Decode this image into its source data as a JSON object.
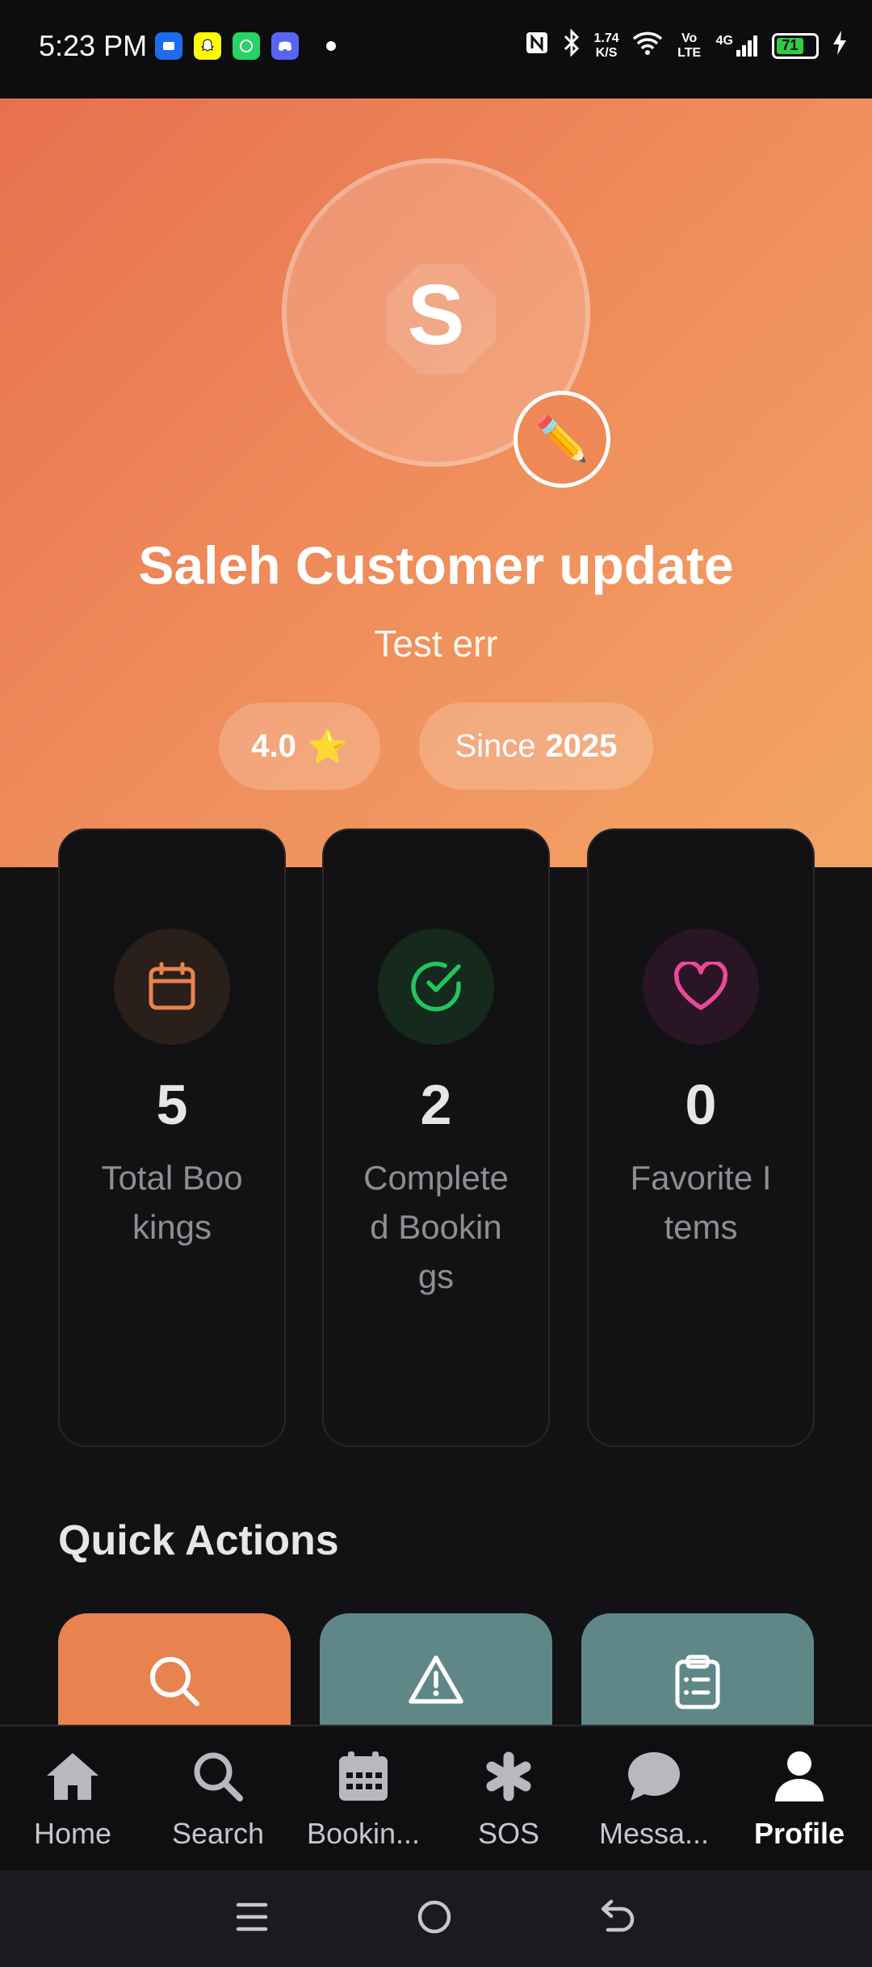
{
  "status_bar": {
    "time": "5:23 PM",
    "net_speed_value": "1.74",
    "net_speed_unit": "K/S",
    "volte": "Vo LTE",
    "network": "4G",
    "battery": "71"
  },
  "profile": {
    "avatar_letter": "S",
    "name": "Saleh Customer update",
    "subtitle": "Test err",
    "rating": "4.0",
    "since_label": "Since",
    "since_year": "2025"
  },
  "stats": [
    {
      "value": "5",
      "label": "Total Bookings",
      "icon": "calendar-icon",
      "color": "#e8834f"
    },
    {
      "value": "2",
      "label": "Completed Bookings",
      "icon": "check-circle-icon",
      "color": "#22c55e"
    },
    {
      "value": "0",
      "label": "Favorite Items",
      "icon": "heart-icon",
      "color": "#ec4899"
    }
  ],
  "quick_actions": {
    "title": "Quick Actions",
    "items": [
      {
        "icon": "search-icon",
        "color": "#e8834f"
      },
      {
        "icon": "warning-icon",
        "color": "#5f8787"
      },
      {
        "icon": "clipboard-icon",
        "color": "#5f8787"
      }
    ]
  },
  "nav": {
    "items": [
      {
        "label": "Home",
        "icon": "home-icon"
      },
      {
        "label": "Search",
        "icon": "search-icon"
      },
      {
        "label": "Bookin...",
        "icon": "calendar-icon"
      },
      {
        "label": "SOS",
        "icon": "asterisk-icon"
      },
      {
        "label": "Messa...",
        "icon": "chat-icon"
      },
      {
        "label": "Profile",
        "icon": "user-icon"
      }
    ],
    "active": "Profile"
  }
}
